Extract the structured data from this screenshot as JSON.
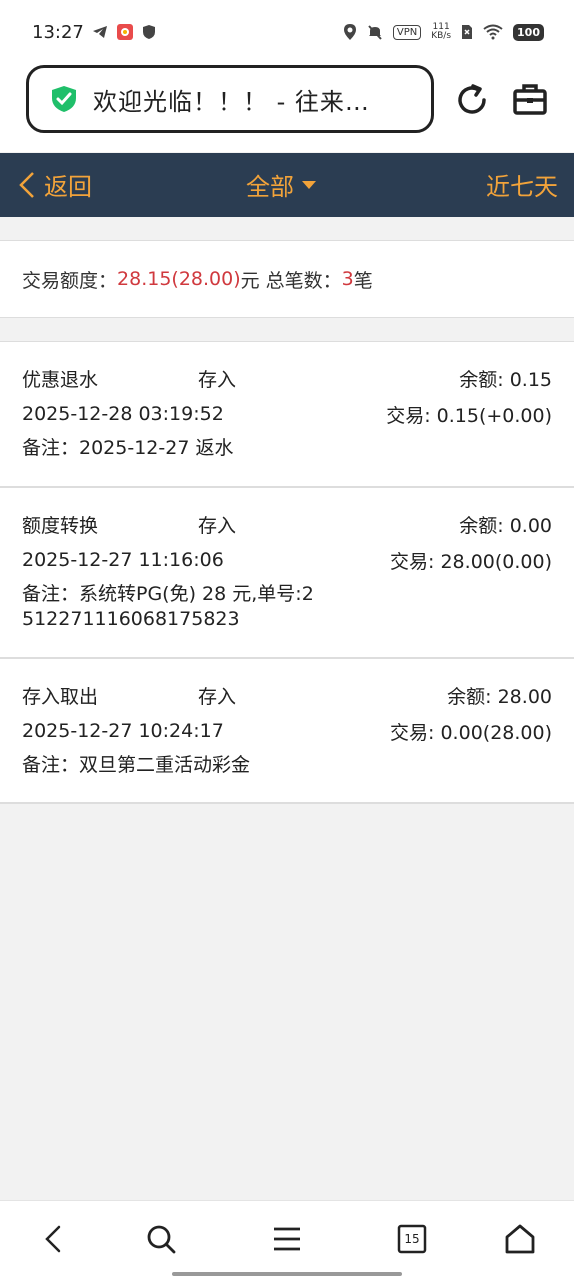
{
  "status_bar": {
    "time": "13:27",
    "vpn": "VPN",
    "speed_value": "111",
    "speed_unit": "KB/s",
    "battery": "100"
  },
  "browser": {
    "url_title": "欢迎光临！！！ - 往来…",
    "shield_color": "#1fbf6a"
  },
  "nav": {
    "back_label": "返回",
    "filter_label": "全部",
    "range_label": "近七天",
    "accent": "#f2a33a",
    "bg": "#2b3d52"
  },
  "summary": {
    "amount_label": "交易额度：",
    "amount_value": "28.15(28.00)",
    "amount_unit": "元",
    "count_label": "总笔数：",
    "count_value": "3",
    "count_unit": "笔"
  },
  "records": [
    {
      "type": "优惠退水",
      "direction": "存入",
      "balance": "余额: 0.15",
      "time": "2025-12-28 03:19:52",
      "transaction": "交易: 0.15(+0.00)",
      "note": "备注：2025-12-27 返水"
    },
    {
      "type": "额度转换",
      "direction": "存入",
      "balance": "余额: 0.00",
      "time": "2025-12-27 11:16:06",
      "transaction": "交易: 28.00(0.00)",
      "note": "备注：系统转PG(免) 28 元,单号:2512271116068175823"
    },
    {
      "type": "存入取出",
      "direction": "存入",
      "balance": "余额: 28.00",
      "time": "2025-12-27 10:24:17",
      "transaction": "交易: 0.00(28.00)",
      "note": "备注：双旦第二重活动彩金"
    }
  ],
  "bottom_nav": {
    "tab_count": "15"
  }
}
